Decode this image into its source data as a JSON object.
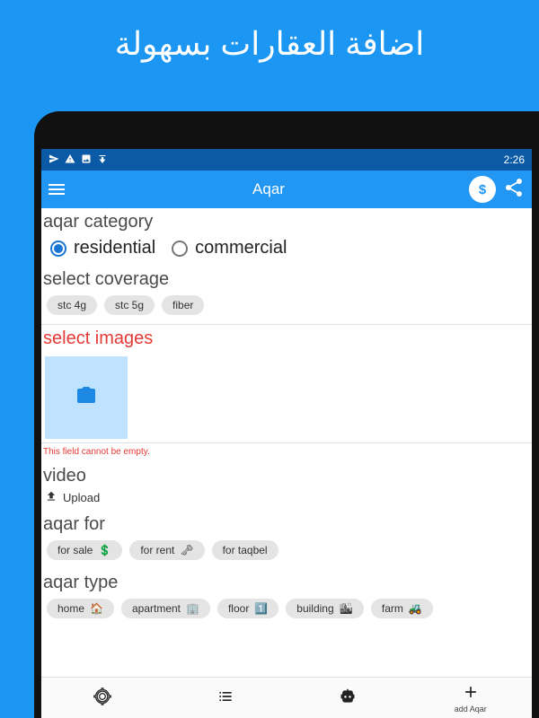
{
  "promo_title": "اضافة العقارات بسهولة",
  "status": {
    "time": "2:26"
  },
  "appbar": {
    "title": "Aqar"
  },
  "category": {
    "label": "aqar category",
    "options": [
      {
        "label": "residential",
        "selected": true
      },
      {
        "label": "commercial",
        "selected": false
      }
    ]
  },
  "coverage": {
    "label": "select coverage",
    "chips": [
      {
        "label": "stc 4g"
      },
      {
        "label": "stc 5g"
      },
      {
        "label": "fiber"
      }
    ]
  },
  "images": {
    "label": "select images",
    "error": "This field cannot be empty."
  },
  "video": {
    "label": "video",
    "upload_label": "Upload"
  },
  "aqar_for": {
    "label": "aqar for",
    "chips": [
      {
        "label": "for sale",
        "icon": "💲"
      },
      {
        "label": "for rent",
        "icon": "🗝"
      },
      {
        "label": "for taqbel",
        "icon": ""
      }
    ]
  },
  "aqar_type": {
    "label": "aqar type",
    "chips": [
      {
        "label": "home",
        "icon": "🏠"
      },
      {
        "label": "apartment",
        "icon": "🏢"
      },
      {
        "label": "floor",
        "icon": "1️⃣"
      },
      {
        "label": "building",
        "icon": "🏙"
      },
      {
        "label": "farm",
        "icon": "🚜"
      }
    ]
  },
  "bottom_nav": {
    "items": [
      {
        "label": "",
        "icon": "locate"
      },
      {
        "label": "",
        "icon": "list"
      },
      {
        "label": "",
        "icon": "robot"
      },
      {
        "label": "add Aqar",
        "icon": "plus"
      }
    ]
  }
}
